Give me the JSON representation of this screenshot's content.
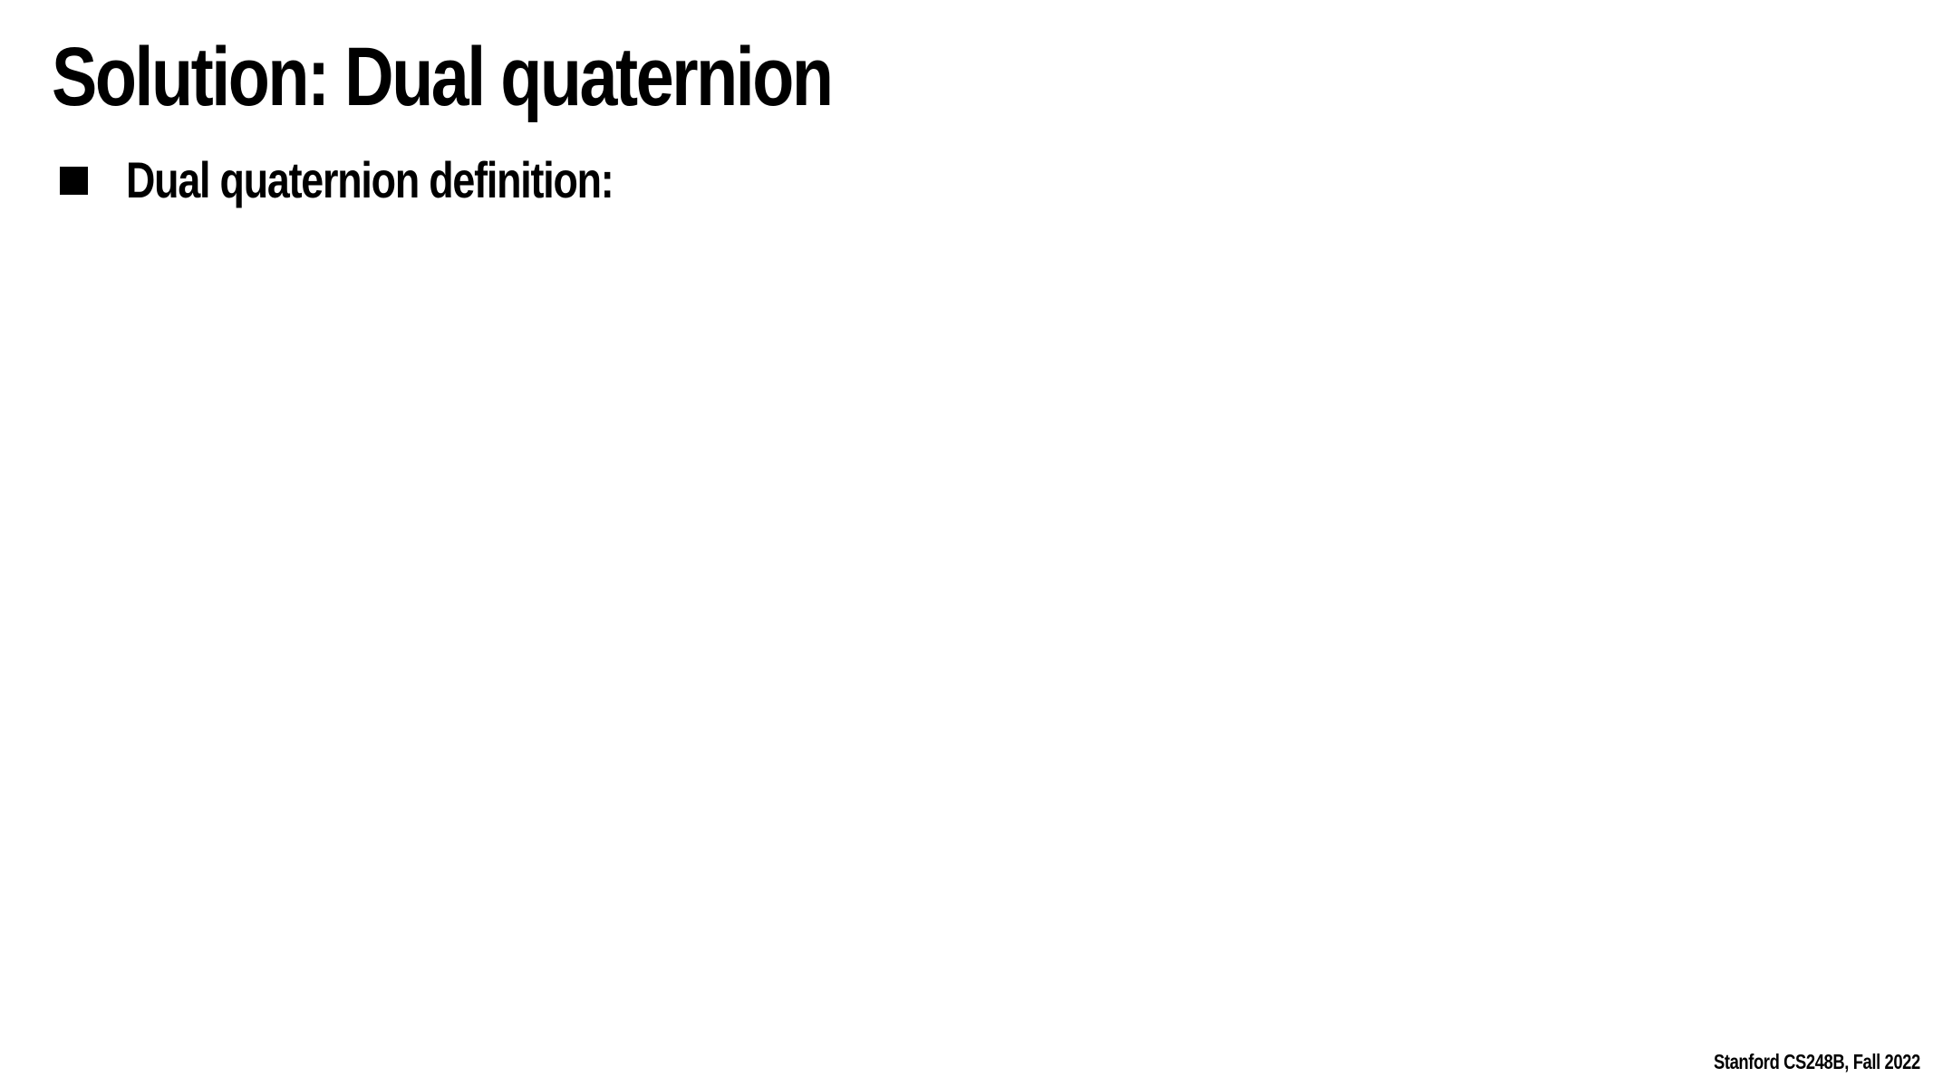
{
  "slide": {
    "title": "Solution: Dual quaternion",
    "bullets": [
      {
        "text": "Dual quaternion definition:"
      }
    ],
    "footer": "Stanford CS248B, Fall 2022"
  }
}
